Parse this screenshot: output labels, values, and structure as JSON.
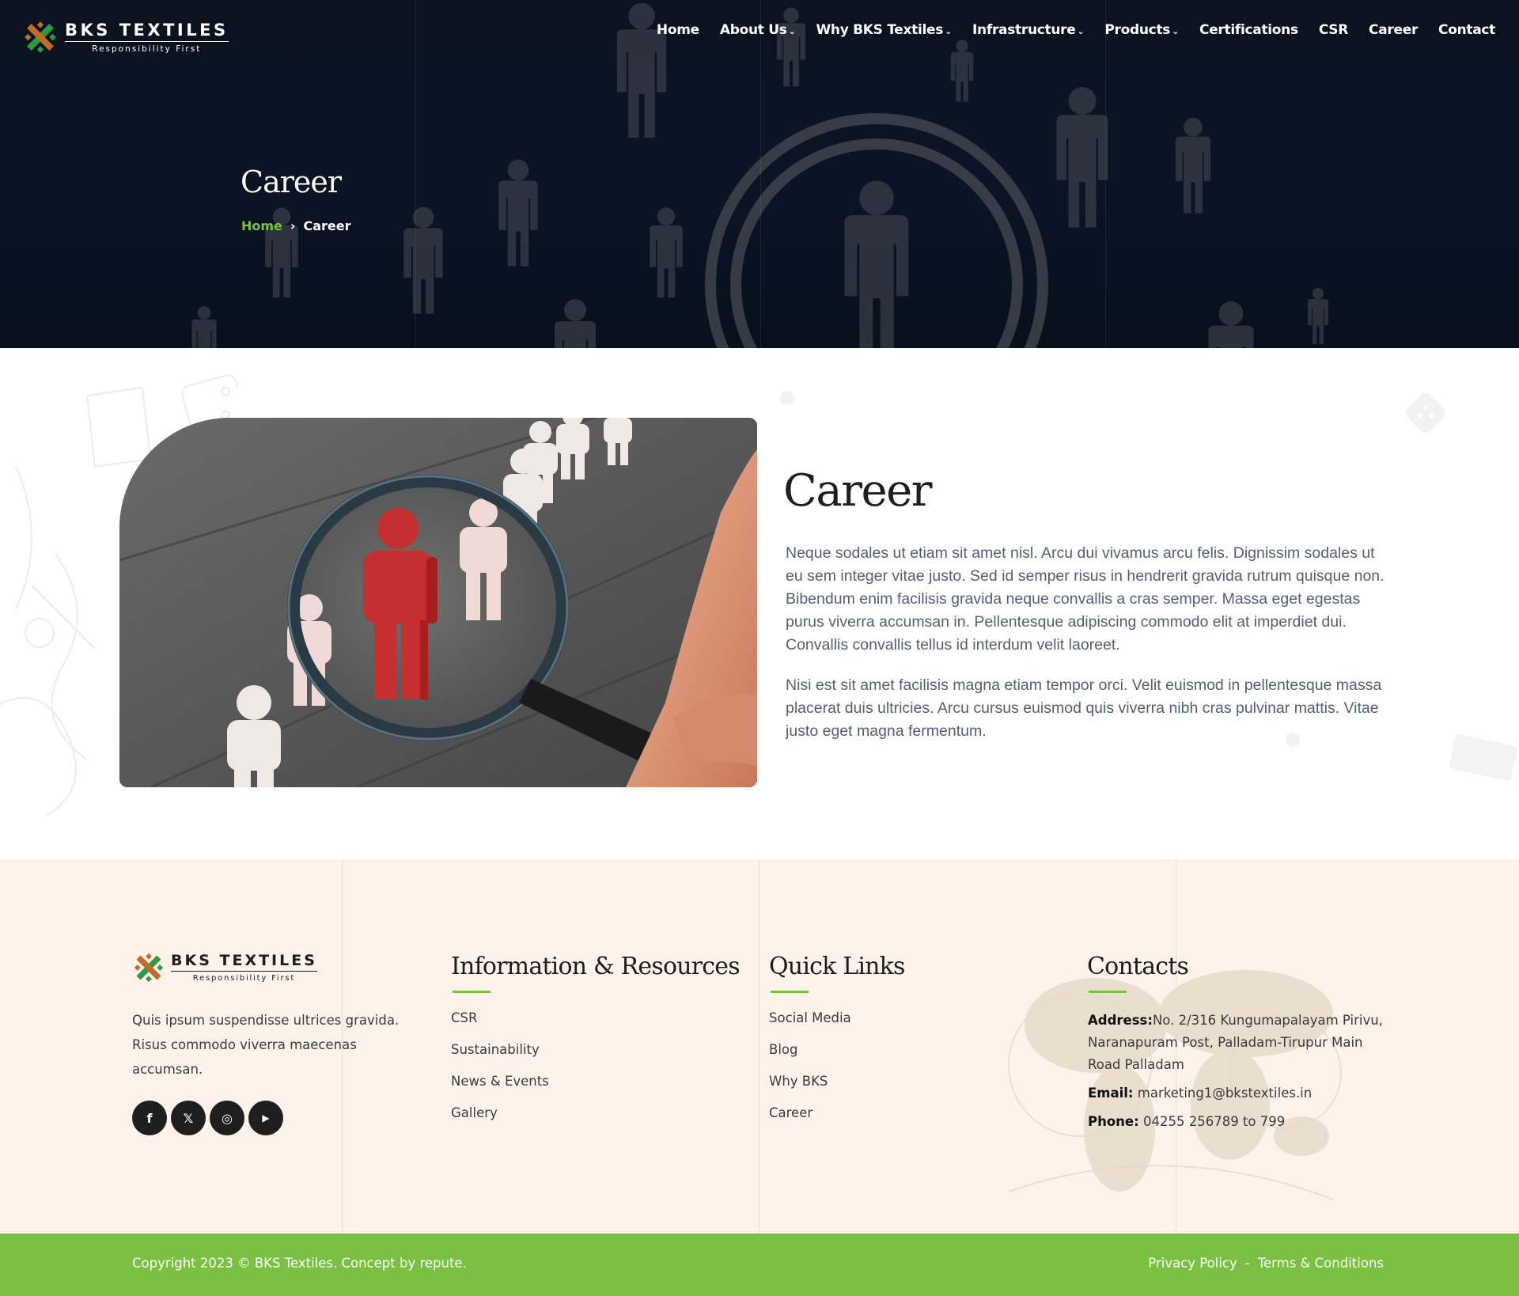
{
  "brand": {
    "name": "BKS TEXTILES",
    "tagline": "Responsibility First",
    "colors": {
      "accent": "#7ac143",
      "hero_bg": "#0b1320",
      "footer_bg": "#fdf3ea",
      "text": "#545e78"
    }
  },
  "nav": {
    "items": [
      {
        "label": "Home",
        "has_dropdown": false
      },
      {
        "label": "About Us",
        "has_dropdown": true
      },
      {
        "label": "Why BKS Textiles",
        "has_dropdown": true
      },
      {
        "label": "Infrastructure",
        "has_dropdown": true
      },
      {
        "label": "Products",
        "has_dropdown": true
      },
      {
        "label": "Certifications",
        "has_dropdown": false
      },
      {
        "label": "CSR",
        "has_dropdown": false
      },
      {
        "label": "Career",
        "has_dropdown": false
      },
      {
        "label": "Contact",
        "has_dropdown": false
      }
    ],
    "dropdown_icon": "chevron-down-icon"
  },
  "hero": {
    "title": "Career",
    "breadcrumb": {
      "home": "Home",
      "separator": "›",
      "current": "Career"
    }
  },
  "content": {
    "heading": "Career",
    "paragraphs": [
      "Neque sodales ut etiam sit amet nisl. Arcu dui vivamus arcu felis. Dignissim sodales ut eu sem integer vitae justo. Sed id semper risus in hendrerit gravida rutrum quisque non. Bibendum enim facilisis gravida neque convallis a cras semper. Massa eget egestas purus viverra accumsan in. Pellentesque adipiscing commodo elit at imperdiet dui. Convallis convallis tellus id interdum velit laoreet.",
      "Nisi est sit amet facilisis magna etiam tempor orci. Velit euismod in pellentesque massa placerat duis ultricies. Arcu cursus euismod quis viverra nibh cras pulvinar mattis. Vitae justo eget magna fermentum."
    ]
  },
  "footer": {
    "about": "Quis ipsum suspendisse ultrices gravida. Risus commodo viverra maecenas accumsan.",
    "socials": [
      {
        "icon": "facebook-icon",
        "glyph": "f"
      },
      {
        "icon": "x-icon",
        "glyph": "𝕏"
      },
      {
        "icon": "instagram-icon",
        "glyph": "◎"
      },
      {
        "icon": "youtube-icon",
        "glyph": "▶"
      }
    ],
    "info": {
      "heading": "Information & Resources",
      "links": [
        "CSR",
        "Sustainability",
        "News & Events",
        "Gallery"
      ]
    },
    "quick": {
      "heading": "Quick Links",
      "links": [
        "Social Media",
        "Blog",
        "Why BKS",
        "Career"
      ]
    },
    "contacts": {
      "heading": "Contacts",
      "address_label": "Address:",
      "address": "No. 2/316 Kungumapalayam Pirivu, Naranapuram Post, Palladam-Tirupur Main Road Palladam",
      "email_label": "Email:",
      "email": "marketing1@bkstextiles.in",
      "phone_label": "Phone:",
      "phone": "04255 256789 to 799"
    },
    "copyright": "Copyright 2023 © BKS Textiles. Concept by repute.",
    "privacy": "Privacy Policy",
    "separator": "-",
    "terms": "Terms & Conditions"
  }
}
